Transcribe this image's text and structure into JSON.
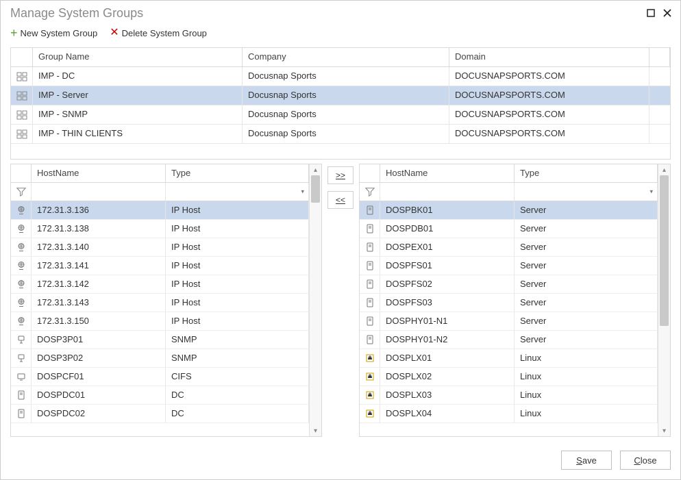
{
  "window": {
    "title": "Manage System Groups"
  },
  "toolbar": {
    "new_label": "New System Group",
    "delete_label": "Delete System Group"
  },
  "groups_table": {
    "headers": {
      "name": "Group Name",
      "company": "Company",
      "domain": "Domain"
    },
    "rows": [
      {
        "name": "IMP - DC",
        "company": "Docusnap Sports",
        "domain": "DOCUSNAPSPORTS.COM",
        "selected": false
      },
      {
        "name": "IMP - Server",
        "company": "Docusnap Sports",
        "domain": "DOCUSNAPSPORTS.COM",
        "selected": true
      },
      {
        "name": "IMP - SNMP",
        "company": "Docusnap Sports",
        "domain": "DOCUSNAPSPORTS.COM",
        "selected": false
      },
      {
        "name": "IMP - THIN CLIENTS",
        "company": "Docusnap Sports",
        "domain": "DOCUSNAPSPORTS.COM",
        "selected": false
      }
    ]
  },
  "left_list": {
    "headers": {
      "host": "HostName",
      "type": "Type"
    },
    "rows": [
      {
        "host": "172.31.3.136",
        "type": "IP Host",
        "icon": "globe",
        "selected": true
      },
      {
        "host": "172.31.3.138",
        "type": "IP Host",
        "icon": "globe",
        "selected": false
      },
      {
        "host": "172.31.3.140",
        "type": "IP Host",
        "icon": "globe",
        "selected": false
      },
      {
        "host": "172.31.3.141",
        "type": "IP Host",
        "icon": "globe",
        "selected": false
      },
      {
        "host": "172.31.3.142",
        "type": "IP Host",
        "icon": "globe",
        "selected": false
      },
      {
        "host": "172.31.3.143",
        "type": "IP Host",
        "icon": "globe",
        "selected": false
      },
      {
        "host": "172.31.3.150",
        "type": "IP Host",
        "icon": "globe",
        "selected": false
      },
      {
        "host": "DOSP3P01",
        "type": "SNMP",
        "icon": "snmp",
        "selected": false
      },
      {
        "host": "DOSP3P02",
        "type": "SNMP",
        "icon": "snmp",
        "selected": false
      },
      {
        "host": "DOSPCF01",
        "type": "CIFS",
        "icon": "cifs",
        "selected": false
      },
      {
        "host": "DOSPDC01",
        "type": "DC",
        "icon": "server",
        "selected": false
      },
      {
        "host": "DOSPDC02",
        "type": "DC",
        "icon": "server",
        "selected": false
      }
    ]
  },
  "right_list": {
    "headers": {
      "host": "HostName",
      "type": "Type"
    },
    "rows": [
      {
        "host": "DOSPBK01",
        "type": "Server",
        "icon": "server",
        "selected": true
      },
      {
        "host": "DOSPDB01",
        "type": "Server",
        "icon": "server",
        "selected": false
      },
      {
        "host": "DOSPEX01",
        "type": "Server",
        "icon": "server",
        "selected": false
      },
      {
        "host": "DOSPFS01",
        "type": "Server",
        "icon": "server",
        "selected": false
      },
      {
        "host": "DOSPFS02",
        "type": "Server",
        "icon": "server",
        "selected": false
      },
      {
        "host": "DOSPFS03",
        "type": "Server",
        "icon": "server",
        "selected": false
      },
      {
        "host": "DOSPHY01-N1",
        "type": "Server",
        "icon": "server",
        "selected": false
      },
      {
        "host": "DOSPHY01-N2",
        "type": "Server",
        "icon": "server",
        "selected": false
      },
      {
        "host": "DOSPLX01",
        "type": "Linux",
        "icon": "linux",
        "selected": false
      },
      {
        "host": "DOSPLX02",
        "type": "Linux",
        "icon": "linux",
        "selected": false
      },
      {
        "host": "DOSPLX03",
        "type": "Linux",
        "icon": "linux",
        "selected": false
      },
      {
        "host": "DOSPLX04",
        "type": "Linux",
        "icon": "linux",
        "selected": false
      }
    ]
  },
  "transfer": {
    "add": ">>",
    "remove": "<<"
  },
  "footer": {
    "save": "Save",
    "close": "Close",
    "save_u": "S",
    "save_rest": "ave",
    "close_u": "C",
    "close_rest": "lose"
  }
}
